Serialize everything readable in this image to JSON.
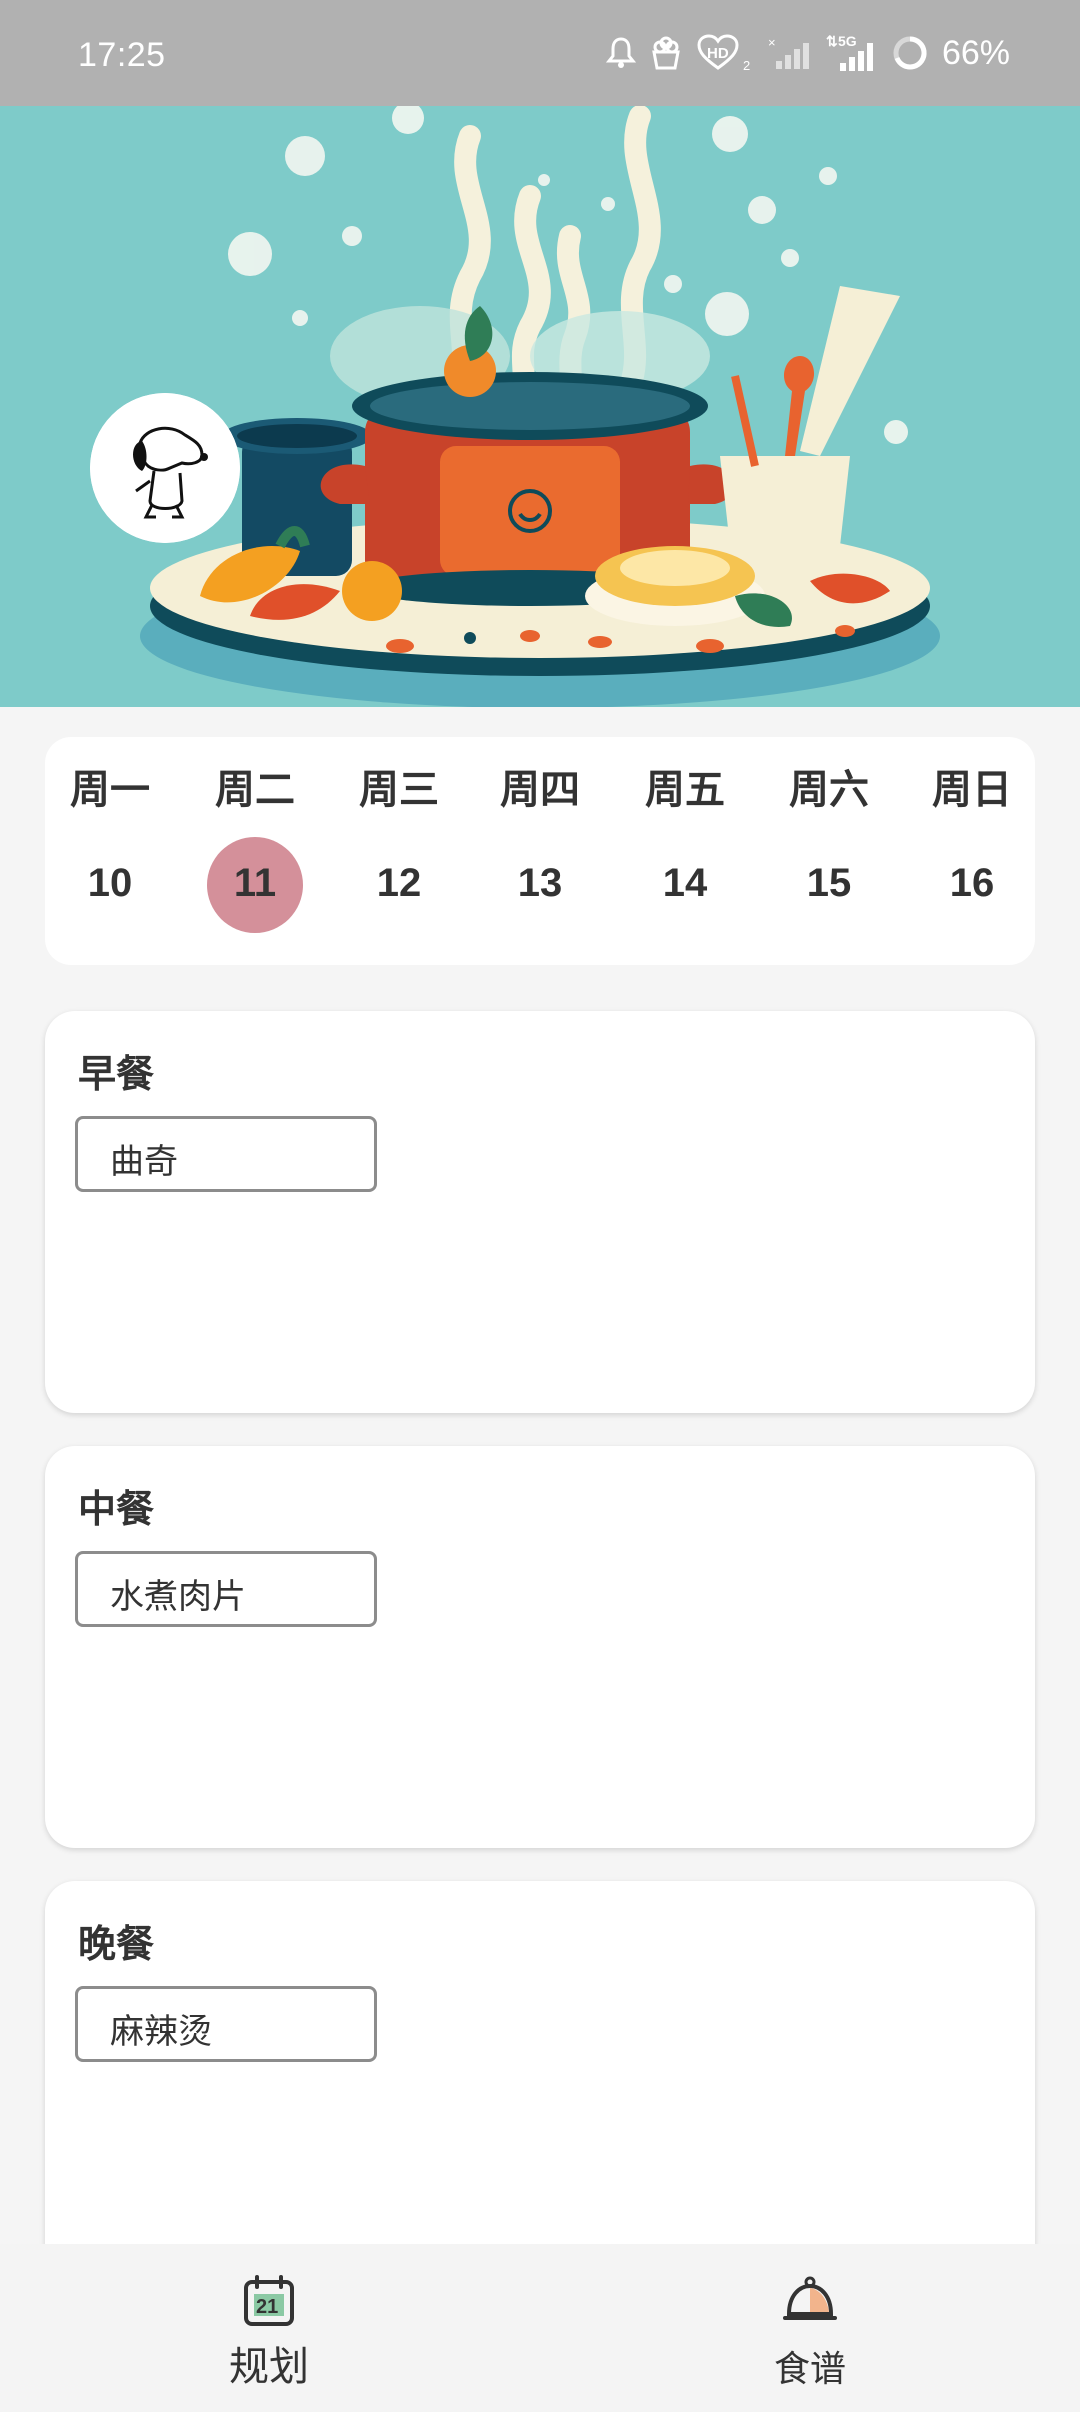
{
  "status_bar": {
    "time": "17:25",
    "network": "5G",
    "hd_label": "HD",
    "battery": "66%",
    "icons": [
      "notification-bell-icon",
      "cake-icon",
      "hd-voice-icon",
      "signal-icon",
      "signal-5g-icon",
      "battery-ring-icon"
    ]
  },
  "banner": {
    "image": "cooking-pot-illustration",
    "avatar": "snoopy-avatar"
  },
  "week": {
    "days": [
      {
        "name": "周一",
        "date": "10"
      },
      {
        "name": "周二",
        "date": "11"
      },
      {
        "name": "周三",
        "date": "12"
      },
      {
        "name": "周四",
        "date": "13"
      },
      {
        "name": "周五",
        "date": "14"
      },
      {
        "name": "周六",
        "date": "15"
      },
      {
        "name": "周日",
        "date": "16"
      }
    ],
    "selected_date": "11",
    "selected_color": "#d4909a"
  },
  "meals": {
    "breakfast": {
      "title": "早餐",
      "dish": "曲奇"
    },
    "lunch": {
      "title": "中餐",
      "dish": "水煮肉片"
    },
    "dinner": {
      "title": "晚餐",
      "dish": "麻辣烫"
    }
  },
  "nav": {
    "plan": {
      "label": "规划",
      "icon": "calendar-icon",
      "calendar_day": "21"
    },
    "recipes": {
      "label": "食谱",
      "icon": "cloche-icon"
    }
  },
  "colors": {
    "banner_bg": "#7ecbc9",
    "page_bg": "#f5f5f5",
    "accent_orange": "#e8632f"
  }
}
